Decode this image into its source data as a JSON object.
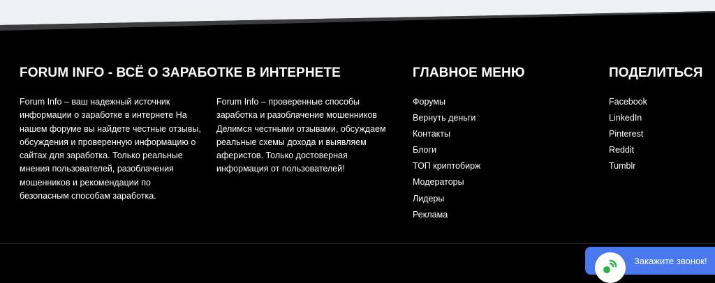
{
  "about": {
    "heading": "FORUM INFO - ВСЁ О ЗАРАБОТКЕ В ИНТЕРНЕТЕ",
    "text_left": "Forum Info – ваш надежный источник информации о заработке в интернете На нашем форуме вы найдете честные отзывы, обсуждения и проверенную информацию о сайтах для заработка. Только реальные мнения пользователей, разоблачения мошенников и рекомендации по безопасным способам заработка.",
    "text_right": "Forum Info – проверенные способы заработка и разоблачение мошенников Делимся честными отзывами, обсуждаем реальные схемы дохода и выявляем аферистов. Только достоверная информация от пользователей!"
  },
  "main_menu": {
    "heading": "ГЛАВНОЕ МЕНЮ",
    "items": [
      "Форумы",
      "Вернуть деньги",
      "Контакты",
      "Блоги",
      "ТОП криптобирж",
      "Модераторы",
      "Лидеры",
      "Реклама"
    ]
  },
  "share": {
    "heading": "ПОДЕЛИТЬСЯ",
    "items": [
      "Facebook",
      "LinkedIn",
      "Pinterest",
      "Reddit",
      "Tumblr"
    ]
  },
  "callback": {
    "label": "Закажите звонок!",
    "icon": "phone-icon"
  },
  "colors": {
    "background": "#000000",
    "page_top": "#edf0f5",
    "accent_blue": "#4a78ee",
    "phone_green": "#2fb24a"
  }
}
